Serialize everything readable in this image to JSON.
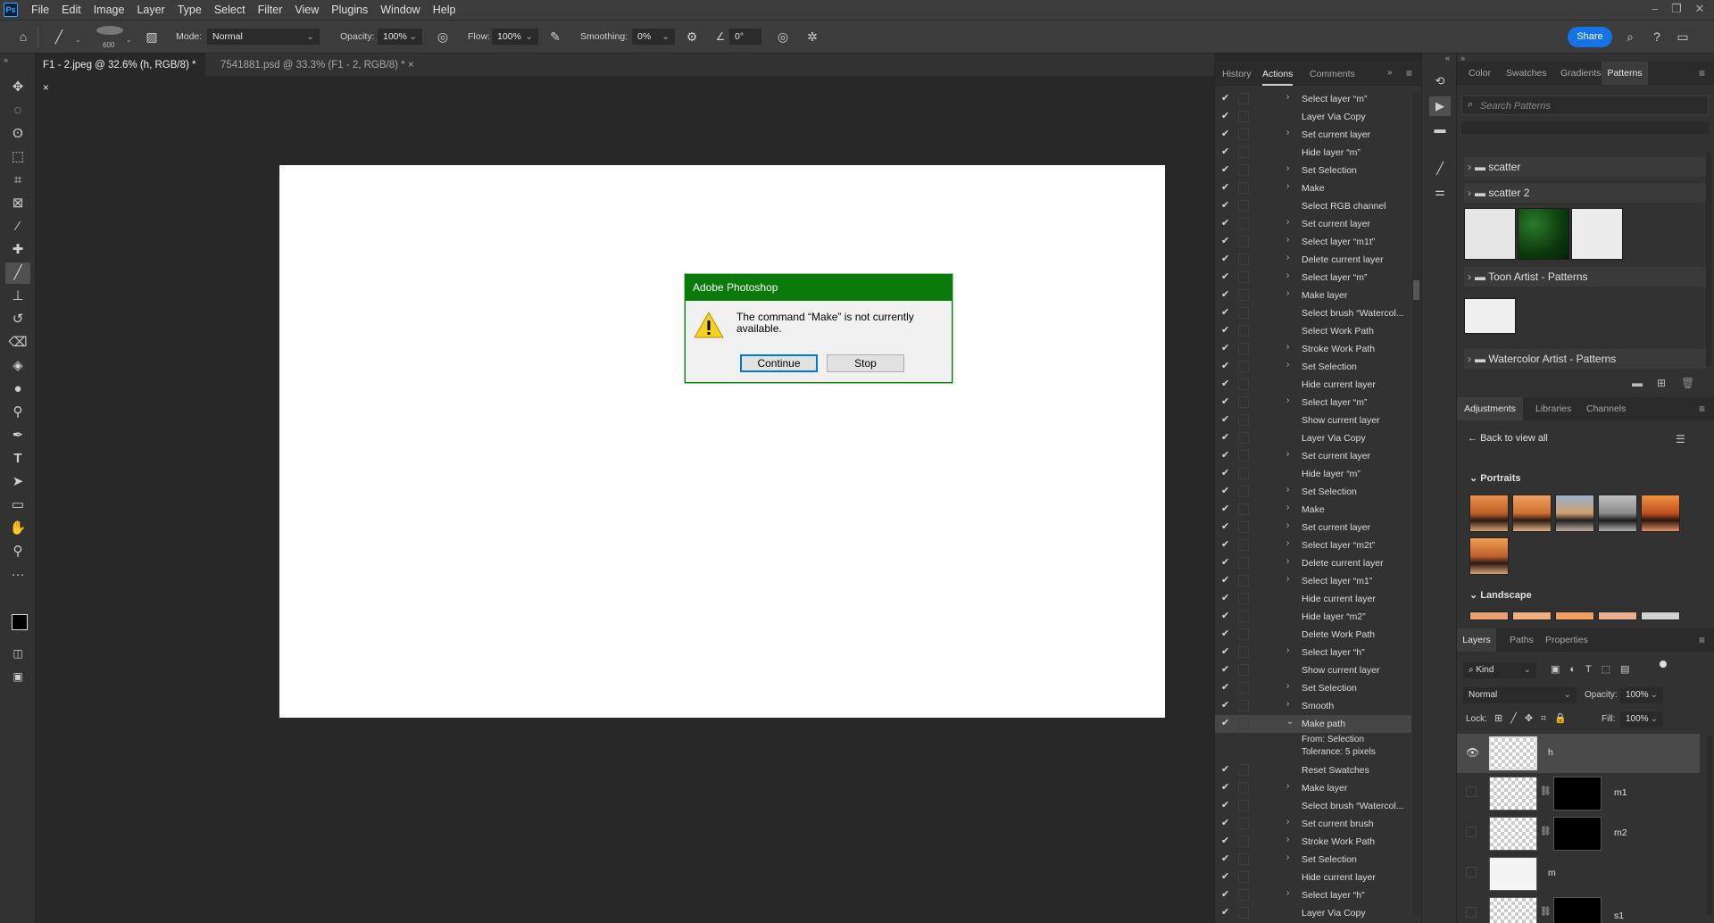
{
  "app": {
    "logo": "Ps"
  },
  "menu": [
    "File",
    "Edit",
    "Image",
    "Layer",
    "Type",
    "Select",
    "Filter",
    "View",
    "Plugins",
    "Window",
    "Help"
  ],
  "options": {
    "brush_size": "600",
    "mode_label": "Mode:",
    "mode_value": "Normal",
    "opacity_label": "Opacity:",
    "opacity_value": "100%",
    "flow_label": "Flow:",
    "flow_value": "100%",
    "smoothing_label": "Smoothing:",
    "smoothing_value": "0%",
    "angle_value": "0°",
    "share_label": "Share"
  },
  "doc_tabs": [
    {
      "label": "F1 - 2.jpeg @ 32.6% (h, RGB/8) *",
      "close": "×"
    },
    {
      "label": "7541881.psd @ 33.3% (F1 - 2, RGB/8) *",
      "close": "×"
    }
  ],
  "dialog": {
    "title": "Adobe Photoshop",
    "message": "The command “Make” is not currently available.",
    "continue_label": "Continue",
    "stop_label": "Stop"
  },
  "history_panel": {
    "tabs": [
      "History",
      "Actions",
      "Comments"
    ],
    "actions": [
      {
        "label": "Select layer “m”",
        "arrow": true
      },
      {
        "label": "Layer Via Copy",
        "arrow": false
      },
      {
        "label": "Set current layer",
        "arrow": true
      },
      {
        "label": "Hide layer “m”",
        "arrow": false
      },
      {
        "label": "Set Selection",
        "arrow": true
      },
      {
        "label": "Make",
        "arrow": true
      },
      {
        "label": "Select RGB channel",
        "arrow": false
      },
      {
        "label": "Set current layer",
        "arrow": true
      },
      {
        "label": "Select layer “m1t”",
        "arrow": true
      },
      {
        "label": "Delete current layer",
        "arrow": true
      },
      {
        "label": "Select layer “m”",
        "arrow": true
      },
      {
        "label": "Make layer",
        "arrow": true
      },
      {
        "label": "Select brush “Watercol...",
        "arrow": false
      },
      {
        "label": "Select Work Path",
        "arrow": false
      },
      {
        "label": "Stroke Work Path",
        "arrow": true
      },
      {
        "label": "Set Selection",
        "arrow": true
      },
      {
        "label": "Hide current layer",
        "arrow": false
      },
      {
        "label": "Select layer “m”",
        "arrow": true
      },
      {
        "label": "Show current layer",
        "arrow": false
      },
      {
        "label": "Layer Via Copy",
        "arrow": false
      },
      {
        "label": "Set current layer",
        "arrow": true
      },
      {
        "label": "Hide layer “m”",
        "arrow": false
      },
      {
        "label": "Set Selection",
        "arrow": true
      },
      {
        "label": "Make",
        "arrow": true
      },
      {
        "label": "Set current layer",
        "arrow": true
      },
      {
        "label": "Select layer “m2t”",
        "arrow": true
      },
      {
        "label": "Delete current layer",
        "arrow": true
      },
      {
        "label": "Select layer “m1”",
        "arrow": true
      },
      {
        "label": "Hide current layer",
        "arrow": false
      },
      {
        "label": "Hide layer “m2”",
        "arrow": false
      },
      {
        "label": "Delete Work Path",
        "arrow": false
      },
      {
        "label": "Select layer “h”",
        "arrow": true
      },
      {
        "label": "Show current layer",
        "arrow": false
      },
      {
        "label": "Set Selection",
        "arrow": true
      },
      {
        "label": "Smooth",
        "arrow": true
      },
      {
        "label": "Make path",
        "arrow": true,
        "expanded": true
      }
    ],
    "make_path_detail": [
      "From: Selection",
      "Tolerance: 5 pixels"
    ],
    "actions_after": [
      {
        "label": "Reset Swatches",
        "arrow": false
      },
      {
        "label": "Make layer",
        "arrow": true
      },
      {
        "label": "Select brush “Watercol...",
        "arrow": false
      },
      {
        "label": "Set current brush",
        "arrow": true
      },
      {
        "label": "Stroke Work Path",
        "arrow": true
      },
      {
        "label": "Set Selection",
        "arrow": true
      },
      {
        "label": "Hide current layer",
        "arrow": false
      },
      {
        "label": "Select layer “h”",
        "arrow": true
      },
      {
        "label": "Layer Via Copy",
        "arrow": false
      }
    ]
  },
  "patterns_panel": {
    "tabs": [
      "Color",
      "Swatches",
      "Gradients",
      "Patterns"
    ],
    "search_placeholder": "Search Patterns",
    "folders": [
      "scatter",
      "scatter 2",
      "Toon Artist - Patterns",
      "Watercolor Artist - Patterns"
    ]
  },
  "adjustments_panel": {
    "tabs": [
      "Adjustments",
      "Libraries",
      "Channels"
    ],
    "back_label": "Back to view all",
    "sections": [
      "Portraits",
      "Landscape"
    ]
  },
  "layers_panel": {
    "tabs": [
      "Layers",
      "Paths",
      "Properties"
    ],
    "kind_label": "Kind",
    "blend_mode": "Normal",
    "opacity_label": "Opacity:",
    "opacity_value": "100%",
    "lock_label": "Lock:",
    "fill_label": "Fill:",
    "fill_value": "100%",
    "layers": [
      "h",
      "m1",
      "m2",
      "m",
      "s1"
    ]
  }
}
